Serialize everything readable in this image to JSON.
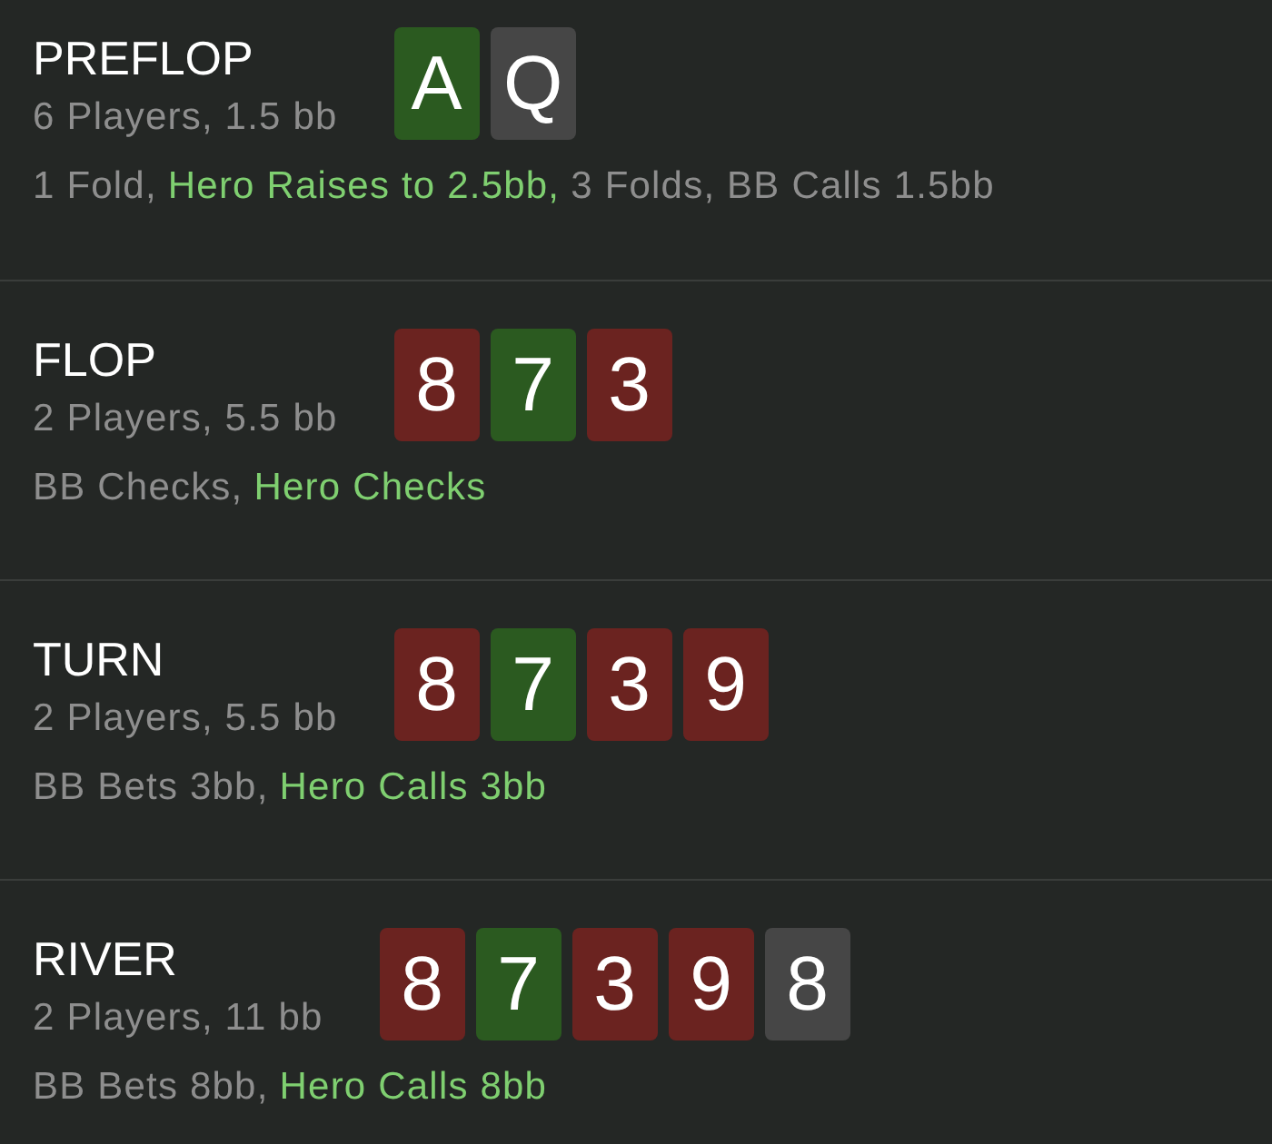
{
  "streets": [
    {
      "name": "PREFLOP",
      "summary": "6 Players, 1.5 bb",
      "cards": [
        {
          "rank": "A",
          "color": "#2b5a20"
        },
        {
          "rank": "Q",
          "color": "#464646"
        }
      ],
      "actions": [
        {
          "text": "1 Fold,",
          "hero": false
        },
        {
          "text": "Hero Raises to 2.5bb,",
          "hero": true
        },
        {
          "text": "3 Folds, BB Calls 1.5bb",
          "hero": false
        }
      ]
    },
    {
      "name": "FLOP",
      "summary": "2 Players, 5.5 bb",
      "cards": [
        {
          "rank": "8",
          "color": "#6b2320"
        },
        {
          "rank": "7",
          "color": "#2b5a20"
        },
        {
          "rank": "3",
          "color": "#6b2320"
        }
      ],
      "actions": [
        {
          "text": "BB Checks,",
          "hero": false
        },
        {
          "text": "Hero Checks",
          "hero": true
        }
      ]
    },
    {
      "name": "TURN",
      "summary": "2 Players, 5.5 bb",
      "cards": [
        {
          "rank": "8",
          "color": "#6b2320"
        },
        {
          "rank": "7",
          "color": "#2b5a20"
        },
        {
          "rank": "3",
          "color": "#6b2320"
        },
        {
          "rank": "9",
          "color": "#6b2320"
        }
      ],
      "actions": [
        {
          "text": "BB Bets 3bb,",
          "hero": false
        },
        {
          "text": "Hero Calls 3bb",
          "hero": true
        }
      ]
    },
    {
      "name": "RIVER",
      "summary": "2 Players, 11 bb",
      "cards": [
        {
          "rank": "8",
          "color": "#6b2320"
        },
        {
          "rank": "7",
          "color": "#2b5a20"
        },
        {
          "rank": "3",
          "color": "#6b2320"
        },
        {
          "rank": "9",
          "color": "#6b2320"
        },
        {
          "rank": "8",
          "color": "#464646"
        }
      ],
      "actions": [
        {
          "text": "BB Bets 8bb,",
          "hero": false
        },
        {
          "text": "Hero Calls 8bb",
          "hero": true
        }
      ]
    }
  ]
}
